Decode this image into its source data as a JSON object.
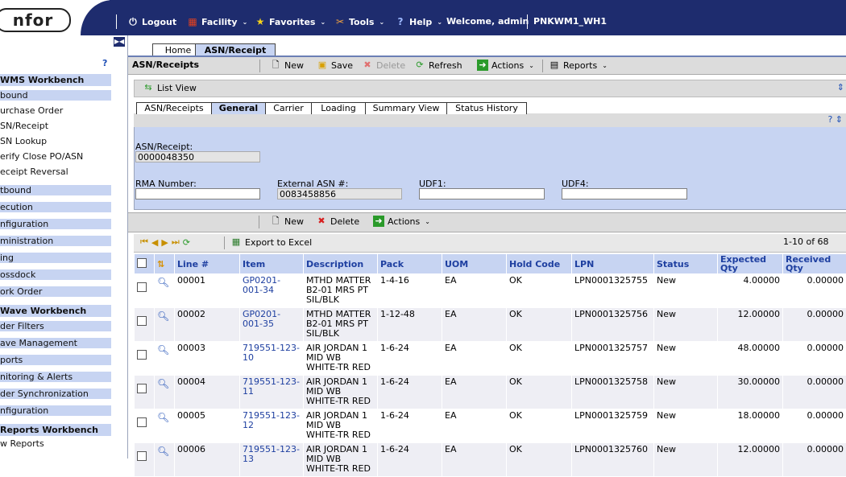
{
  "top": {
    "logo": "nfor",
    "menu": [
      {
        "label": "Logout",
        "icon": "power-icon"
      },
      {
        "label": "Facility",
        "icon": "building-icon"
      },
      {
        "label": "Favorites",
        "icon": "star-icon"
      },
      {
        "label": "Tools",
        "icon": "tools-icon"
      },
      {
        "label": "Help",
        "icon": "help-icon"
      }
    ],
    "welcome": "Welcome, admin",
    "instance": "PNKWM1_WH1"
  },
  "sidebar": {
    "sections": [
      {
        "title": "WMS Workbench",
        "items": [
          "bound",
          "urchase Order",
          "SN/Receipt",
          "SN Lookup",
          "erify Close PO/ASN",
          "eceipt Reversal"
        ]
      },
      {
        "title": "",
        "items": [
          "tbound",
          "ecution",
          "nfiguration",
          "ministration",
          "ing",
          "ossdock",
          "ork Order"
        ]
      },
      {
        "title": "Wave Workbench",
        "items": [
          "der Filters",
          "ave Management",
          "ports",
          "nitoring & Alerts",
          "der Synchronization",
          "nfiguration"
        ]
      },
      {
        "title": "Reports Workbench",
        "items": [
          "w Reports"
        ]
      }
    ]
  },
  "tabs": {
    "home": "Home",
    "asn": "ASN/Receipt"
  },
  "toolbar1": {
    "title": "ASN/Receipts",
    "new": "New",
    "save": "Save",
    "delete": "Delete",
    "refresh": "Refresh",
    "actions": "Actions",
    "reports": "Reports"
  },
  "listview": "List View",
  "subtabs": [
    "ASN/Receipts",
    "General",
    "Carrier",
    "Loading",
    "Summary View",
    "Status History"
  ],
  "form": {
    "asn_label": "ASN/Receipt:",
    "asn_value": "0000048350",
    "rma_label": "RMA Number:",
    "rma_value": "",
    "ext_label": "External ASN #:",
    "ext_value": "0083458856",
    "udf1_label": "UDF1:",
    "udf1_value": "",
    "udf4_label": "UDF4:",
    "udf4_value": ""
  },
  "toolbar2": {
    "new": "New",
    "delete": "Delete",
    "actions": "Actions"
  },
  "pager": {
    "export": "Export to Excel",
    "range": "1-10 of 68"
  },
  "grid": {
    "headers": [
      "Line #",
      "Item",
      "Description",
      "Pack",
      "UOM",
      "Hold Code",
      "LPN",
      "Status",
      "Expected Qty",
      "Received Qty"
    ],
    "rows": [
      {
        "line": "00001",
        "item": "GP0201-001-34",
        "desc": "MTHD MATTER B2-01 MRS PT SIL/BLK",
        "pack": "1-4-16",
        "uom": "EA",
        "hold": "OK",
        "lpn": "LPN0001325755",
        "status": "New",
        "exp": "4.00000",
        "rec": "0.00000"
      },
      {
        "line": "00002",
        "item": "GP0201-001-35",
        "desc": "MTHD MATTER B2-01 MRS PT SIL/BLK",
        "pack": "1-12-48",
        "uom": "EA",
        "hold": "OK",
        "lpn": "LPN0001325756",
        "status": "New",
        "exp": "12.00000",
        "rec": "0.00000"
      },
      {
        "line": "00003",
        "item": "719551-123-10",
        "desc": "AIR JORDAN 1 MID WB WHITE-TR RED",
        "pack": "1-6-24",
        "uom": "EA",
        "hold": "OK",
        "lpn": "LPN0001325757",
        "status": "New",
        "exp": "48.00000",
        "rec": "0.00000"
      },
      {
        "line": "00004",
        "item": "719551-123-11",
        "desc": "AIR JORDAN 1 MID WB WHITE-TR RED",
        "pack": "1-6-24",
        "uom": "EA",
        "hold": "OK",
        "lpn": "LPN0001325758",
        "status": "New",
        "exp": "30.00000",
        "rec": "0.00000"
      },
      {
        "line": "00005",
        "item": "719551-123-12",
        "desc": "AIR JORDAN 1 MID WB WHITE-TR RED",
        "pack": "1-6-24",
        "uom": "EA",
        "hold": "OK",
        "lpn": "LPN0001325759",
        "status": "New",
        "exp": "18.00000",
        "rec": "0.00000"
      },
      {
        "line": "00006",
        "item": "719551-123-13",
        "desc": "AIR JORDAN 1 MID WB WHITE-TR RED",
        "pack": "1-6-24",
        "uom": "EA",
        "hold": "OK",
        "lpn": "LPN0001325760",
        "status": "New",
        "exp": "12.00000",
        "rec": "0.00000"
      }
    ]
  }
}
